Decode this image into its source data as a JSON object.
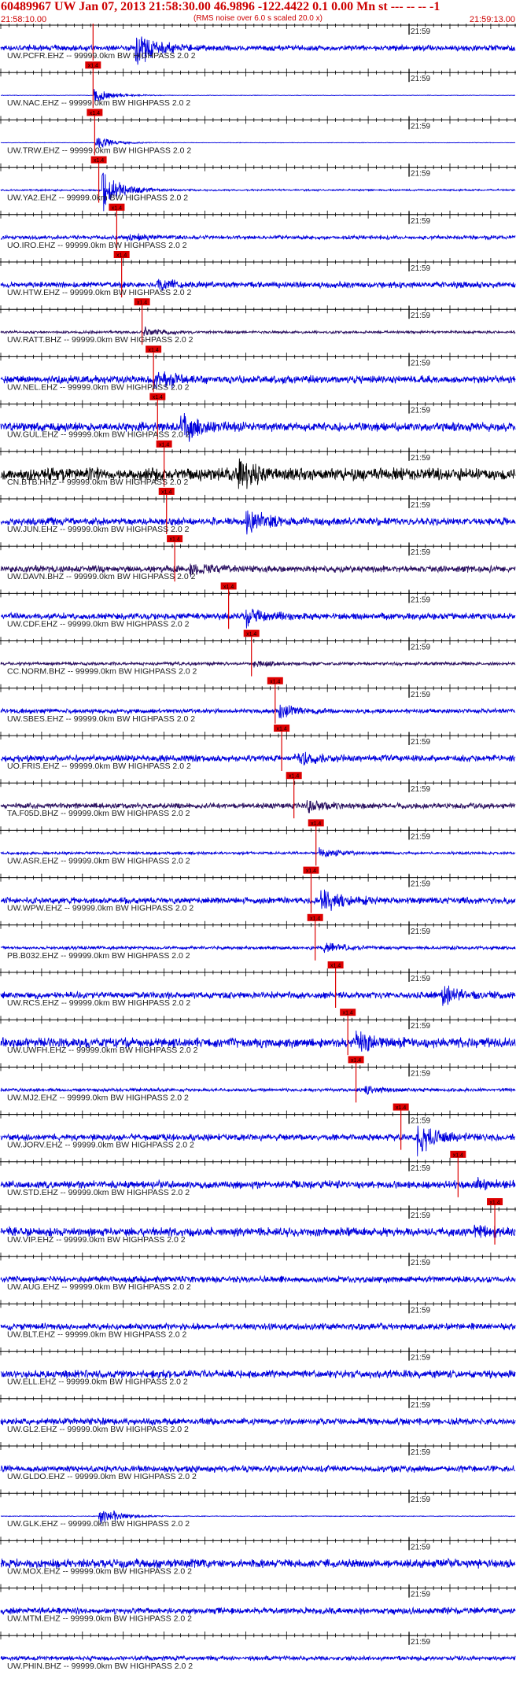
{
  "header": {
    "title": "60489967 UW Jan 07, 2013 21:58:30.00   46.9896 -122.4422  0.1 0.00 Mn st --- -- --  -1",
    "subtitle": "(RMS noise over 6.0 s scaled 20.0 x)",
    "start_time": "21:58:10.00",
    "end_time": "21:59:13.00"
  },
  "chart_data": {
    "type": "seismogram",
    "time_axis": {
      "start": "21:58:10.00",
      "end": "21:59:13.00",
      "minute_label": "21:59",
      "minute_mark_seconds": 50
    },
    "pick_label": "x1.4",
    "filter_suffix": "-- 99999.0km BW  HIGHPASS  2.0  2",
    "colors": {
      "trace": "#0000dd",
      "dark_trace": "#2a1060",
      "black_trace": "#000000",
      "pick": "#dd0000",
      "text": "#222222"
    },
    "traces": [
      {
        "station": "UW.PCFR.EHZ",
        "pick_s": 11.3,
        "color": "blue",
        "burst_s": 16.5,
        "amp": 0.25,
        "burst_amp": 1.9
      },
      {
        "station": "UW.NAC.EHZ",
        "pick_s": 11.3,
        "color": "blue",
        "burst_s": 11.4,
        "amp": 0.02,
        "burst_amp": 0.8
      },
      {
        "station": "UW.TRW.EHZ",
        "pick_s": 11.5,
        "color": "blue",
        "burst_s": 11.6,
        "amp": 0.02,
        "burst_amp": 0.7
      },
      {
        "station": "UW.YA2.EHZ",
        "pick_s": 12.0,
        "color": "blue",
        "burst_s": 12.4,
        "amp": 0.08,
        "burst_amp": 2.0
      },
      {
        "station": "UO.IRO.EHZ",
        "pick_s": 14.2,
        "color": "blue",
        "burst_s": 15.5,
        "amp": 0.18,
        "burst_amp": 0.3
      },
      {
        "station": "UW.HTW.EHZ",
        "pick_s": 14.8,
        "color": "blue",
        "burst_s": 19.0,
        "amp": 0.28,
        "burst_amp": 0.6
      },
      {
        "station": "UW.RATT.BHZ",
        "pick_s": 17.3,
        "color": "dark",
        "burst_s": 17.5,
        "amp": 0.12,
        "burst_amp": 0.4
      },
      {
        "station": "UW.NEL.EHZ",
        "pick_s": 18.7,
        "color": "blue",
        "burst_s": 18.8,
        "amp": 0.35,
        "burst_amp": 1.0
      },
      {
        "station": "UW.GUL.EHZ",
        "pick_s": 19.2,
        "color": "blue",
        "burst_s": 22.0,
        "amp": 0.4,
        "burst_amp": 1.5
      },
      {
        "station": "CN.BTB.HHZ",
        "pick_s": 20.0,
        "color": "black",
        "burst_s": 29.0,
        "amp": 0.6,
        "burst_amp": 1.3
      },
      {
        "station": "UW.JUN.EHZ",
        "pick_s": 20.3,
        "color": "blue",
        "burst_s": 30.0,
        "amp": 0.35,
        "burst_amp": 1.2
      },
      {
        "station": "UW.DAVN.BHZ",
        "pick_s": 21.3,
        "color": "dark",
        "burst_s": 23.0,
        "amp": 0.3,
        "burst_amp": 0.6
      },
      {
        "station": "UW.CDF.EHZ",
        "pick_s": 27.9,
        "color": "blue",
        "burst_s": 30.0,
        "amp": 0.3,
        "burst_amp": 0.9
      },
      {
        "station": "CC.NORM.BHZ",
        "pick_s": 30.7,
        "color": "dark",
        "burst_s": 31.0,
        "amp": 0.15,
        "burst_amp": 0.3
      },
      {
        "station": "UW.SBES.EHZ",
        "pick_s": 33.6,
        "color": "blue",
        "burst_s": 34.0,
        "amp": 0.2,
        "burst_amp": 0.8
      },
      {
        "station": "UO.FRIS.EHZ",
        "pick_s": 34.4,
        "color": "blue",
        "burst_s": 36.0,
        "amp": 0.3,
        "burst_amp": 0.7
      },
      {
        "station": "TA.F05D.BHZ",
        "pick_s": 35.9,
        "color": "dark",
        "burst_s": 37.5,
        "amp": 0.25,
        "burst_amp": 0.6
      },
      {
        "station": "UW.ASR.EHZ",
        "pick_s": 38.6,
        "color": "blue",
        "burst_s": 39.0,
        "amp": 0.12,
        "burst_amp": 0.5
      },
      {
        "station": "UW.WPW.EHZ",
        "pick_s": 38.0,
        "color": "blue",
        "burst_s": 39.2,
        "amp": 0.3,
        "burst_amp": 1.3
      },
      {
        "station": "PB.B032.EHZ",
        "pick_s": 38.5,
        "color": "blue",
        "burst_s": 39.5,
        "amp": 0.15,
        "burst_amp": 0.6
      },
      {
        "station": "UW.RCS.EHZ",
        "pick_s": 41.0,
        "color": "blue",
        "burst_s": 54.0,
        "amp": 0.3,
        "burst_amp": 1.0
      },
      {
        "station": "UW.UWFH.EHZ",
        "pick_s": 42.5,
        "color": "blue",
        "burst_s": 43.5,
        "amp": 0.45,
        "burst_amp": 0.9
      },
      {
        "station": "UW.MJ2.EHZ",
        "pick_s": 43.5,
        "color": "blue",
        "burst_s": 44.5,
        "amp": 0.15,
        "burst_amp": 0.4
      },
      {
        "station": "UW.JORV.EHZ",
        "pick_s": 49.0,
        "color": "blue",
        "burst_s": 51.0,
        "amp": 0.3,
        "burst_amp": 1.6
      },
      {
        "station": "UW.STD.EHZ",
        "pick_s": 56.0,
        "color": "blue",
        "burst_s": 58.0,
        "amp": 0.35,
        "burst_amp": 0.5
      },
      {
        "station": "UW.VIP.EHZ",
        "pick_s": 60.5,
        "color": "blue",
        "burst_s": 58.0,
        "amp": 0.4,
        "burst_amp": 0.5
      },
      {
        "station": "UW.AUG.EHZ",
        "pick_s": null,
        "color": "blue",
        "burst_s": null,
        "amp": 0.3,
        "burst_amp": 0
      },
      {
        "station": "UW.BLT.EHZ",
        "pick_s": null,
        "color": "blue",
        "burst_s": null,
        "amp": 0.3,
        "burst_amp": 0
      },
      {
        "station": "UW.ELL.EHZ",
        "pick_s": null,
        "color": "blue",
        "burst_s": null,
        "amp": 0.35,
        "burst_amp": 0
      },
      {
        "station": "UW.GL2.EHZ",
        "pick_s": null,
        "color": "blue",
        "burst_s": null,
        "amp": 0.3,
        "burst_amp": 0
      },
      {
        "station": "UW.GLDO.EHZ",
        "pick_s": null,
        "color": "blue",
        "burst_s": null,
        "amp": 0.3,
        "burst_amp": 0
      },
      {
        "station": "UW.GLK.EHZ",
        "pick_s": null,
        "color": "blue",
        "burst_s": 12.0,
        "amp": 0.03,
        "burst_amp": 1.1
      },
      {
        "station": "UW.MOX.EHZ",
        "pick_s": null,
        "color": "blue",
        "burst_s": null,
        "amp": 0.4,
        "burst_amp": 0
      },
      {
        "station": "UW.MTM.EHZ",
        "pick_s": null,
        "color": "blue",
        "burst_s": null,
        "amp": 0.3,
        "burst_amp": 0
      },
      {
        "station": "UW.PHIN.BHZ",
        "pick_s": null,
        "color": "blue",
        "burst_s": null,
        "amp": 0.2,
        "burst_amp": 0
      }
    ]
  }
}
